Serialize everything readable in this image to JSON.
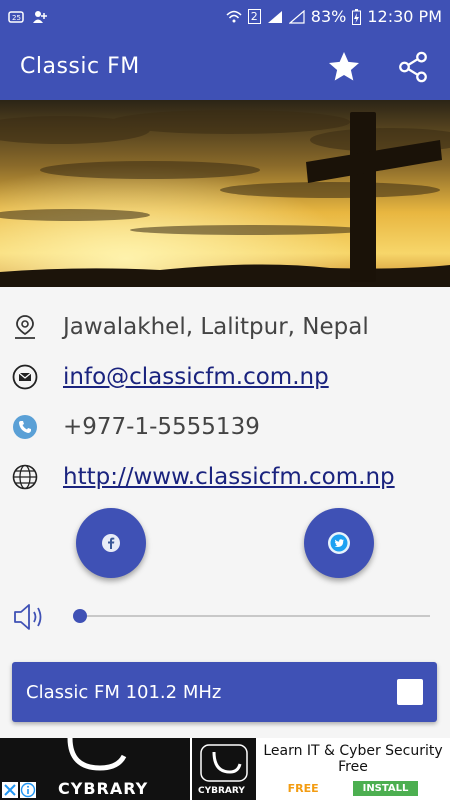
{
  "status": {
    "battery": "83%",
    "time": "12:30 PM",
    "sim": "2"
  },
  "appbar": {
    "title": "Classic FM"
  },
  "contact": {
    "address": "Jawalakhel, Lalitpur, Nepal",
    "email": "info@classicfm.com.np",
    "phone": "+977-1-5555139",
    "website": "http://www.classicfm.com.np"
  },
  "volume": {
    "level": 0.0
  },
  "player": {
    "station": "Classic FM 101.2 MHz"
  },
  "ad": {
    "brand": "CYBRARY",
    "logo_text": "CYBRARY",
    "headline": "Learn IT & Cyber Security Free",
    "free_label": "FREE",
    "install_label": "INSTALL"
  },
  "colors": {
    "primary": "#3f51b5",
    "accent_link": "#1a237e"
  }
}
